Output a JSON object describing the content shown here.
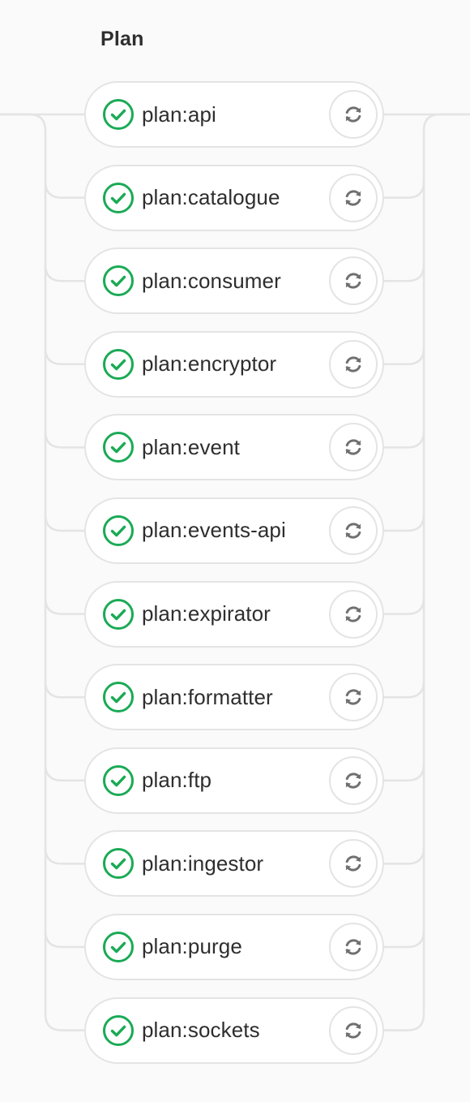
{
  "stage": {
    "title": "Plan"
  },
  "colors": {
    "success": "#1aaa55",
    "connector": "#e4e4e4",
    "retry_icon": "#707070",
    "text": "#2e2e2e",
    "background": "#fafafa"
  },
  "jobs": [
    {
      "name": "plan:api",
      "status": "passed",
      "status_icon": "check-circle-icon",
      "action_icon": "retry-icon"
    },
    {
      "name": "plan:catalogue",
      "status": "passed",
      "status_icon": "check-circle-icon",
      "action_icon": "retry-icon"
    },
    {
      "name": "plan:consumer",
      "status": "passed",
      "status_icon": "check-circle-icon",
      "action_icon": "retry-icon"
    },
    {
      "name": "plan:encryptor",
      "status": "passed",
      "status_icon": "check-circle-icon",
      "action_icon": "retry-icon"
    },
    {
      "name": "plan:event",
      "status": "passed",
      "status_icon": "check-circle-icon",
      "action_icon": "retry-icon"
    },
    {
      "name": "plan:events-api",
      "status": "passed",
      "status_icon": "check-circle-icon",
      "action_icon": "retry-icon"
    },
    {
      "name": "plan:expirator",
      "status": "passed",
      "status_icon": "check-circle-icon",
      "action_icon": "retry-icon"
    },
    {
      "name": "plan:formatter",
      "status": "passed",
      "status_icon": "check-circle-icon",
      "action_icon": "retry-icon"
    },
    {
      "name": "plan:ftp",
      "status": "passed",
      "status_icon": "check-circle-icon",
      "action_icon": "retry-icon"
    },
    {
      "name": "plan:ingestor",
      "status": "passed",
      "status_icon": "check-circle-icon",
      "action_icon": "retry-icon"
    },
    {
      "name": "plan:purge",
      "status": "passed",
      "status_icon": "check-circle-icon",
      "action_icon": "retry-icon"
    },
    {
      "name": "plan:sockets",
      "status": "passed",
      "status_icon": "check-circle-icon",
      "action_icon": "retry-icon"
    }
  ]
}
